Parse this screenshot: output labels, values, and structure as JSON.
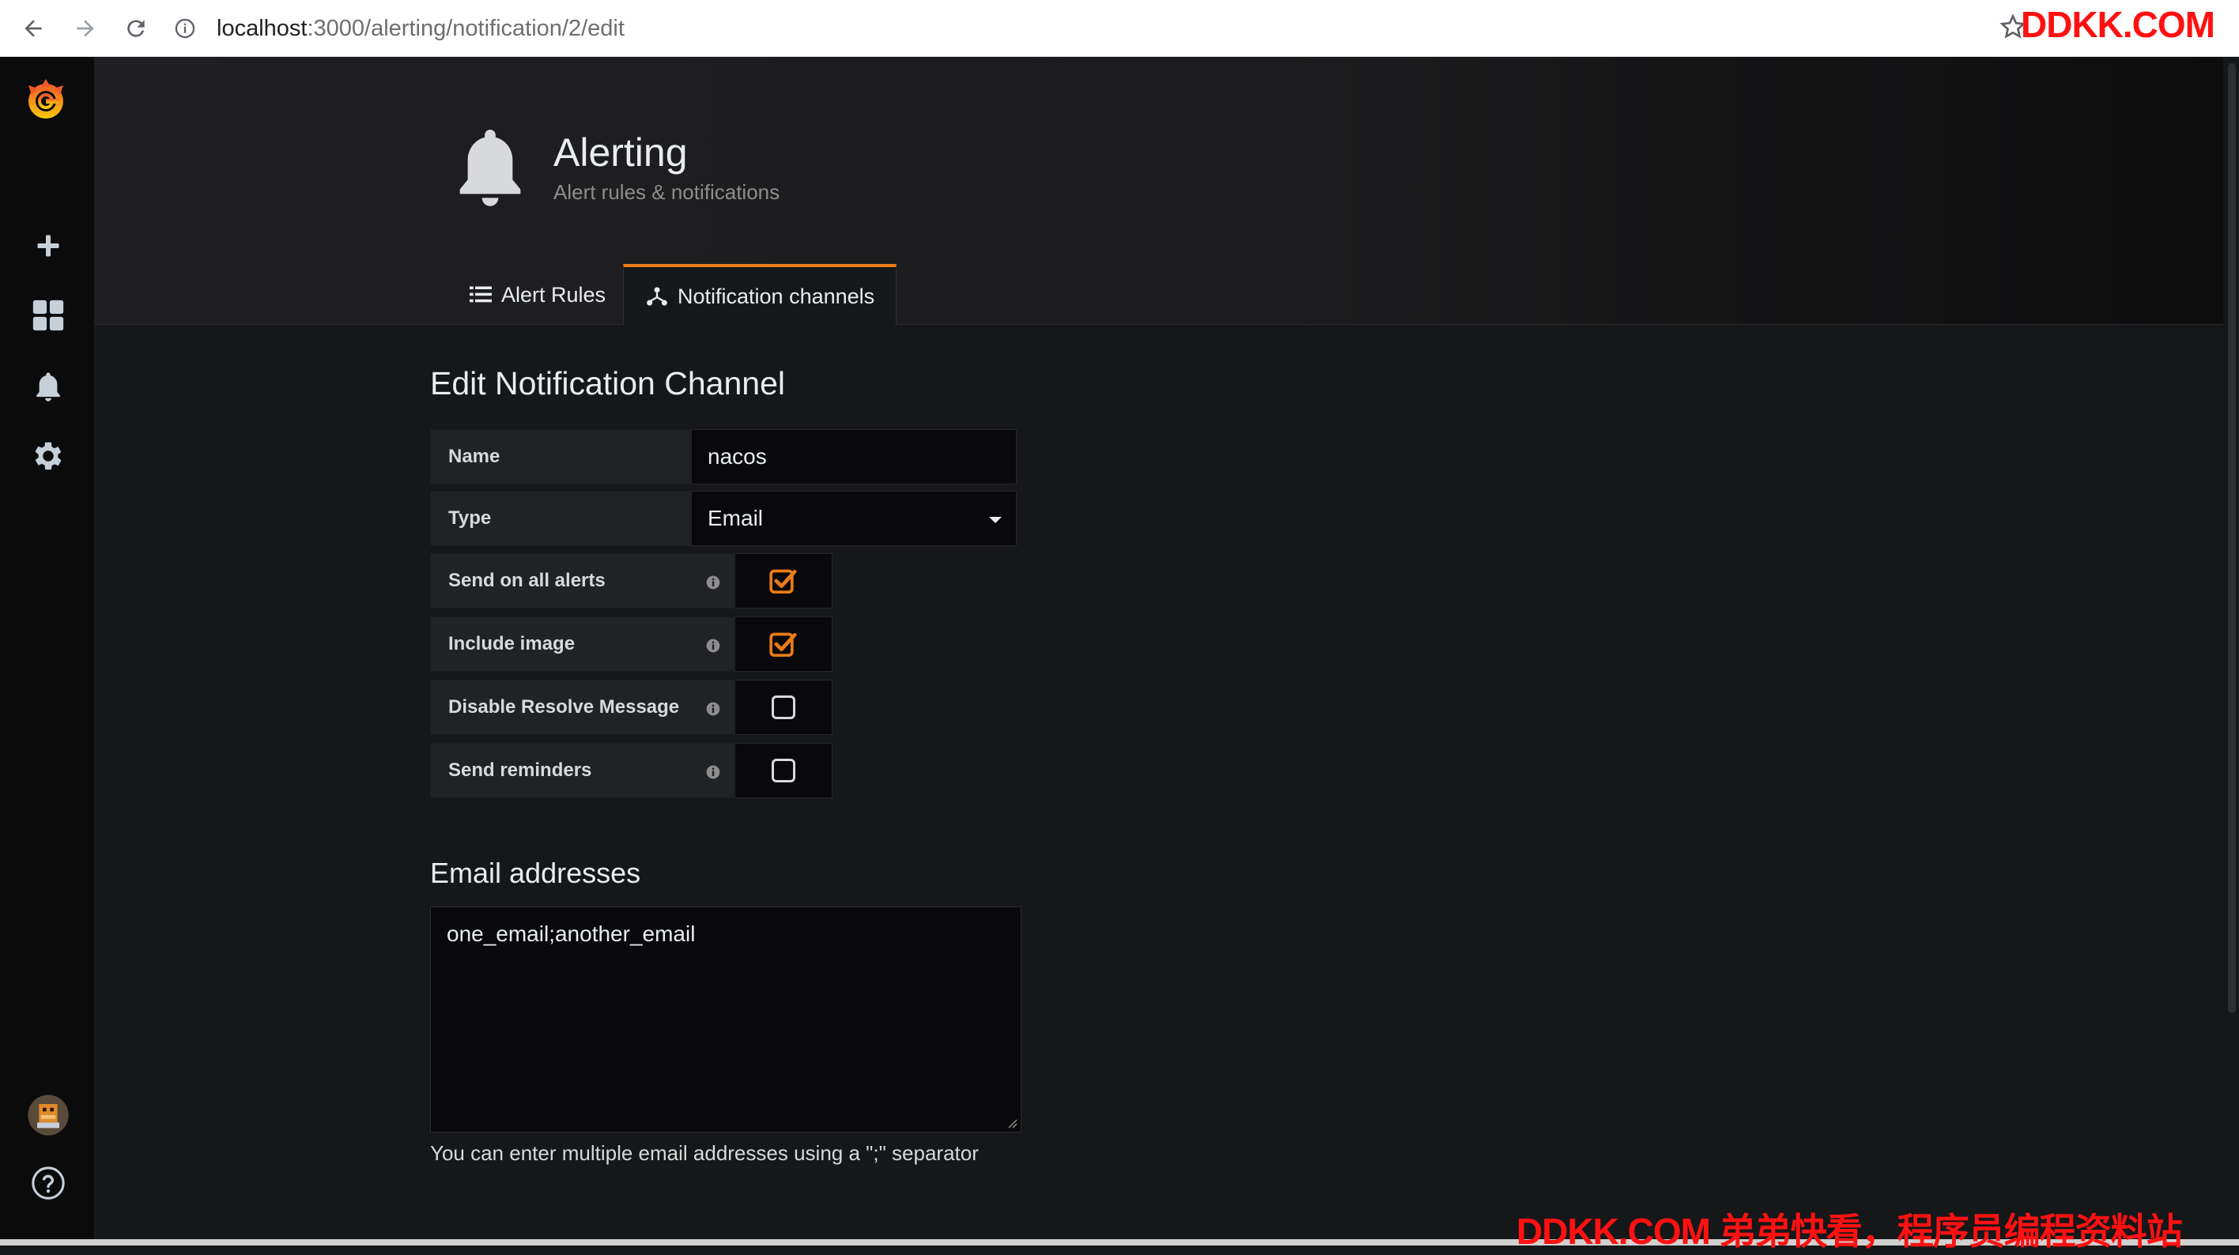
{
  "browser": {
    "url_host": "localhost",
    "url_path": ":3000/alerting/notification/2/edit"
  },
  "watermark": {
    "top": "DDKK.COM",
    "bottom": "DDKK.COM 弟弟快看，程序员编程资料站"
  },
  "header": {
    "title": "Alerting",
    "subtitle": "Alert rules & notifications"
  },
  "tabs": [
    {
      "label": "Alert Rules",
      "active": false
    },
    {
      "label": "Notification channels",
      "active": true
    }
  ],
  "form": {
    "title": "Edit Notification Channel",
    "name_label": "Name",
    "name_value": "nacos",
    "type_label": "Type",
    "type_value": "Email",
    "checks": [
      {
        "label": "Send on all alerts",
        "checked": true
      },
      {
        "label": "Include image",
        "checked": true
      },
      {
        "label": "Disable Resolve Message",
        "checked": false
      },
      {
        "label": "Send reminders",
        "checked": false
      }
    ]
  },
  "email": {
    "title": "Email addresses",
    "value": "one_email;another_email",
    "help": "You can enter multiple email addresses using a \";\" separator"
  },
  "colors": {
    "accent": "#eb7b18",
    "background": "#161719",
    "sidebar": "#0b0b0c"
  },
  "icons": {
    "logo": "grafana-logo-icon",
    "add": "plus-icon",
    "dashboards": "grid-icon",
    "alerting": "bell-icon",
    "config": "gear-icon",
    "profile": "avatar-icon",
    "help": "help-circle-icon"
  }
}
